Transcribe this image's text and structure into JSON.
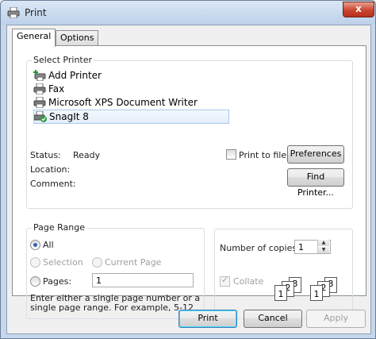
{
  "window": {
    "title": "Print",
    "close_glyph": "x"
  },
  "tabs": [
    {
      "label": "General"
    },
    {
      "label": "Options"
    }
  ],
  "select_printer": {
    "title": "Select Printer",
    "printers": [
      {
        "name": "Add Printer",
        "icon": "add-printer-icon"
      },
      {
        "name": "Fax",
        "icon": "fax-printer-icon"
      },
      {
        "name": "Microsoft XPS Document Writer",
        "icon": "printer-icon"
      },
      {
        "name": "SnagIt 8",
        "icon": "default-printer-icon",
        "selected": true
      }
    ],
    "status_label": "Status:",
    "status_value": "Ready",
    "location_label": "Location:",
    "comment_label": "Comment:",
    "print_to_file_label": "Print to file",
    "preferences_label": "Preferences",
    "find_printer_label": "Find Printer..."
  },
  "page_range": {
    "title": "Page Range",
    "all_label": "All",
    "selection_label": "Selection",
    "current_page_label": "Current Page",
    "pages_label": "Pages:",
    "pages_value": "1",
    "hint": "Enter either a single page number or a single page range.  For example, 5-12"
  },
  "copies": {
    "label": "Number of copies:",
    "value": "1",
    "collate_label": "Collate",
    "collate_page_numbers": [
      "1",
      "2",
      "3"
    ]
  },
  "buttons": {
    "print": "Print",
    "cancel": "Cancel",
    "apply": "Apply"
  }
}
